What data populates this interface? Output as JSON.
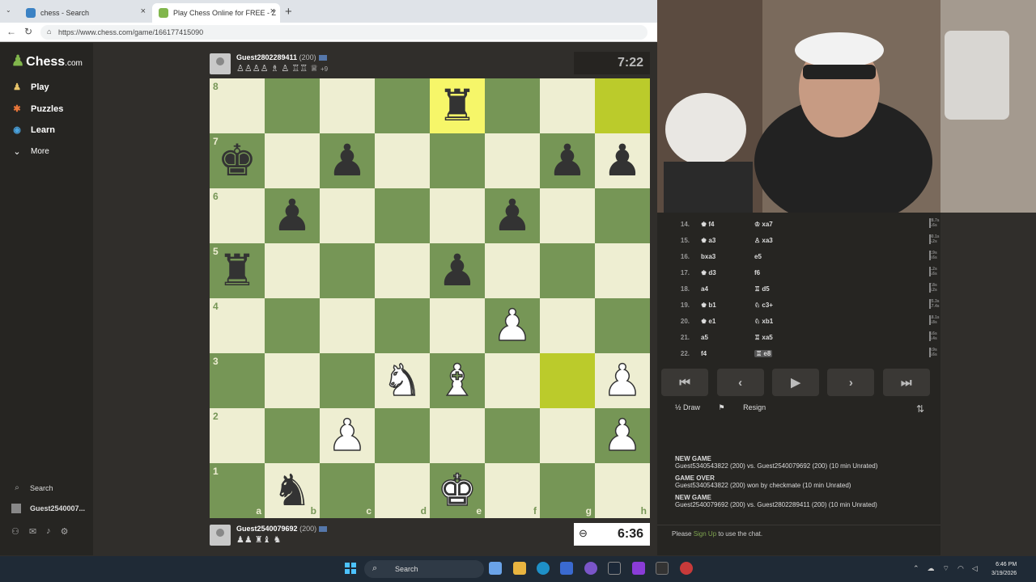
{
  "browser": {
    "tabs": [
      {
        "label": "chess - Search"
      },
      {
        "label": "Play Chess Online for FREE - Z"
      }
    ],
    "url": "https://www.chess.com/game/166177415090"
  },
  "sidebar": {
    "logo": "Chess",
    "logo_suffix": ".com",
    "items": [
      {
        "label": "Play",
        "icon": "play-pawn-icon"
      },
      {
        "label": "Puzzles",
        "icon": "puzzle-icon"
      },
      {
        "label": "Learn",
        "icon": "learn-icon"
      },
      {
        "label": "More",
        "icon": "chevron-down-icon"
      }
    ],
    "search_label": "Search",
    "user_label": "Guest2540007..."
  },
  "game": {
    "top_player": {
      "name": "Guest2802289411",
      "rating": "(200)",
      "captured": "♙♙♙♙ ♗ ♙ ♖♖ ♕",
      "advantage": "+9"
    },
    "bottom_player": {
      "name": "Guest2540079692",
      "rating": "(200)",
      "captured": "♟♟ ♜♝ ♞"
    },
    "top_clock": "7:22",
    "bottom_clock": "6:36",
    "ranks": [
      "8",
      "7",
      "6",
      "5",
      "4",
      "3",
      "2",
      "1"
    ],
    "files": [
      "a",
      "b",
      "c",
      "d",
      "e",
      "f",
      "g",
      "h"
    ],
    "board": [
      [
        "",
        "",
        "",
        "",
        "r",
        "",
        "",
        ""
      ],
      [
        "k",
        "",
        "p",
        "",
        "",
        "",
        "p",
        "p"
      ],
      [
        "",
        "p",
        "",
        "",
        "",
        "p",
        "",
        ""
      ],
      [
        "r",
        "",
        "",
        "",
        "p",
        "",
        "",
        ""
      ],
      [
        "",
        "",
        "",
        "",
        "",
        "P",
        "",
        ""
      ],
      [
        "",
        "",
        "",
        "N",
        "B",
        "",
        "",
        "P"
      ],
      [
        "",
        "",
        "P",
        "",
        "",
        "",
        "",
        "P"
      ],
      [
        "",
        "n",
        "",
        "",
        "K",
        "",
        "",
        ""
      ]
    ]
  },
  "moves": [
    {
      "num": "14.",
      "white": "♚ f4",
      "black": "♔ xa7",
      "t1": "28.7s",
      "t2": "6.6s"
    },
    {
      "num": "15.",
      "white": "♚ a3",
      "black": "♙ xa3",
      "t1": "30.1s",
      "t2": "5.2s"
    },
    {
      "num": "16.",
      "white": "bxa3",
      "black": "e5",
      "t1": "2.9s",
      "t2": "9.6s"
    },
    {
      "num": "17.",
      "white": "♚ d3",
      "black": "f6",
      "t1": "1.2s",
      "t2": "5.6s"
    },
    {
      "num": "18.",
      "white": "a4",
      "black": "♖ d5",
      "t1": "7.8s",
      "t2": "4.2s"
    },
    {
      "num": "19.",
      "white": "♚ b1",
      "black": "♘ c3+",
      "t1": "25.3s",
      "t2": "17.4s"
    },
    {
      "num": "20.",
      "white": "♚ e1",
      "black": "♘ xb1",
      "t1": "18.1s",
      "t2": "3.8s"
    },
    {
      "num": "21.",
      "white": "a5",
      "black": "♖ xa5",
      "t1": "8.6s",
      "t2": "4.4s"
    },
    {
      "num": "22.",
      "white": "f4",
      "black": "♖ e8",
      "t1": "9.9s",
      "t2": "8.6s"
    }
  ],
  "controls": {
    "first": "⏮",
    "prev": "‹",
    "play": "▶",
    "next": "›",
    "last": "⏭",
    "draw": "½ Draw",
    "resign": "Resign"
  },
  "log": [
    {
      "head": "NEW GAME",
      "text": "Guest5340543822 (200) vs. Guest2540079692 (200) (10 min Unrated)"
    },
    {
      "head": "GAME OVER",
      "text": "Guest5340543822 (200) won by checkmate (10 min Unrated)"
    },
    {
      "head": "NEW GAME",
      "text": "Guest2540079692 (200) vs. Guest2802289411 (200) (10 min Unrated)"
    }
  ],
  "chat": {
    "pre": "Please ",
    "link": "Sign Up",
    "post": " to use the chat."
  },
  "taskbar": {
    "search": "Search",
    "time": "6:46 PM",
    "date": "3/19/2026"
  },
  "colors": {
    "light_square": "#eeeed2",
    "dark_square": "#769656",
    "highlight": "#f6f669",
    "accent": "#81b64c"
  }
}
